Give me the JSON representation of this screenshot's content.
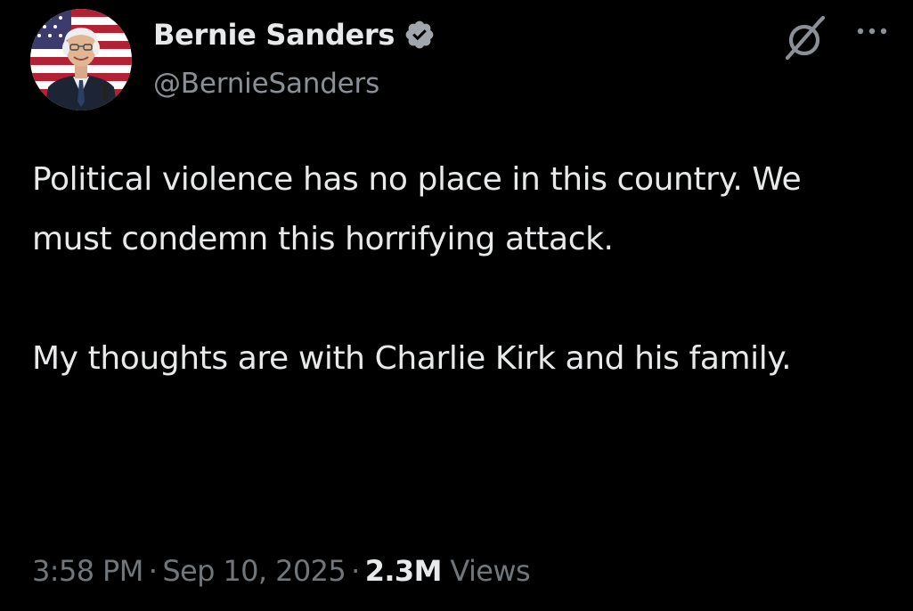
{
  "author": {
    "display_name": "Bernie Sanders",
    "handle": "@BernieSanders",
    "verified": true,
    "avatar_icon": "profile-photo"
  },
  "post": {
    "paragraphs": [
      "Political violence has no place in this country. We must condemn this horrifying attack.",
      "My thoughts are with Charlie Kirk and his family."
    ]
  },
  "meta": {
    "time": "3:58 PM",
    "separator": "·",
    "date": "Sep 10, 2025",
    "views_count": "2.3M",
    "views_label": "Views"
  },
  "icons": {
    "verified": "verified-badge-icon",
    "grok": "grok-icon",
    "more": "more-options-icon"
  },
  "colors": {
    "background": "#000000",
    "primary_text": "#e7e9ea",
    "secondary_text": "#71767b",
    "verified_badge": "#a0a6ab"
  }
}
